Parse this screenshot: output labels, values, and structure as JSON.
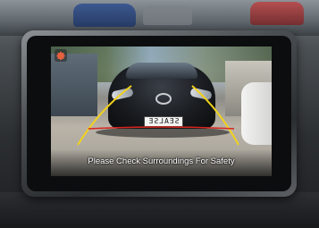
{
  "screen": {
    "warning_text": "Please Check Surroundings For Safety",
    "plate_text": "SEALSE"
  },
  "icons": {
    "settings": "gear-icon"
  },
  "colors": {
    "guide_yellow": "#f2d21b",
    "guide_red": "#d8261f",
    "settings_icon": "#e8623d",
    "text": "#ffffff"
  }
}
